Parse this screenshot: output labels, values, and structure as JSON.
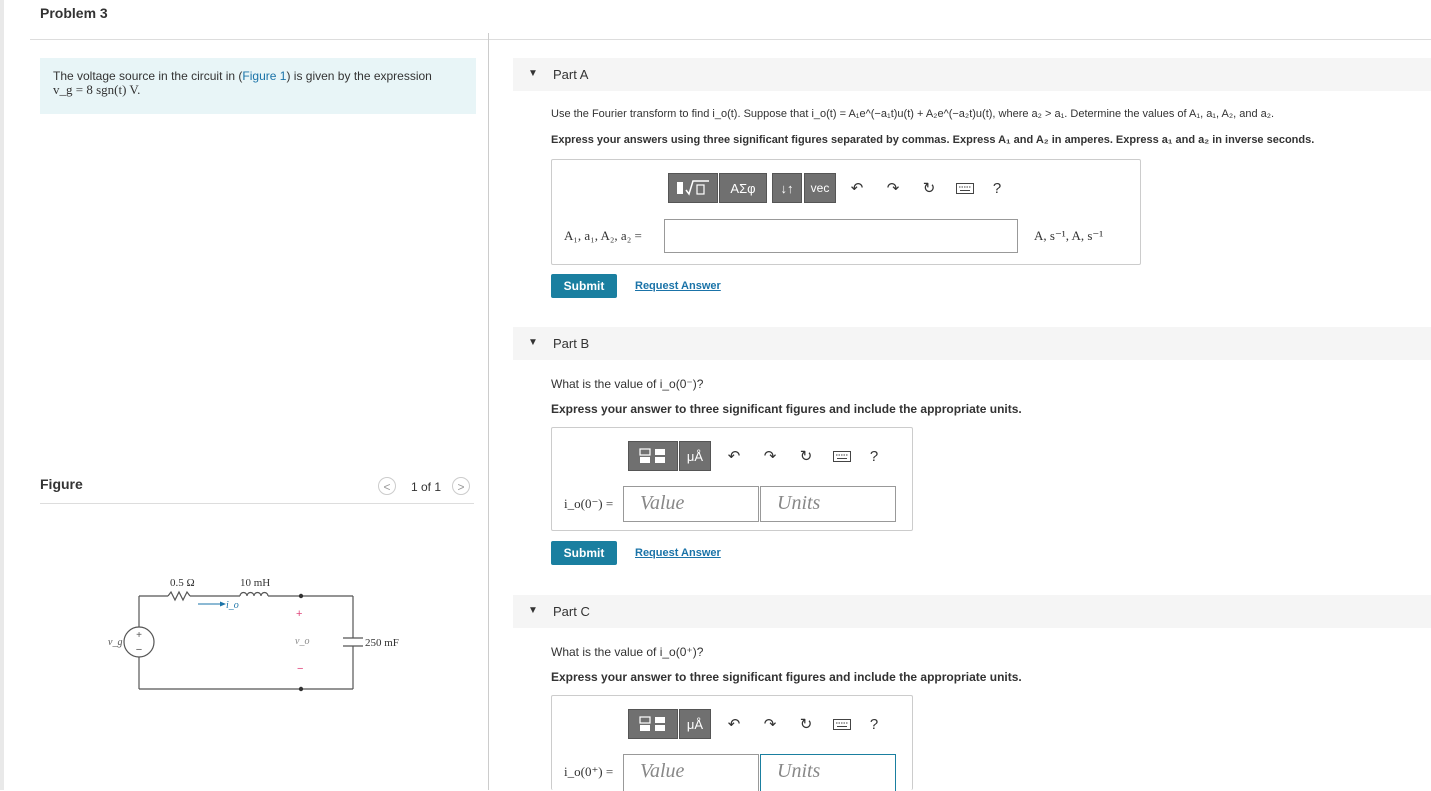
{
  "problem": {
    "title": "Problem 3"
  },
  "statement": {
    "text_before": "The voltage source in the circuit in (",
    "figure_link": "Figure 1",
    "text_after": ") is given by the expression",
    "expr": "v_g = 8 sgn(t) V."
  },
  "figure": {
    "label": "Figure",
    "pager": {
      "prev": "<",
      "count": "1 of 1",
      "next": ">"
    },
    "circuit": {
      "resistor": "0.5 Ω",
      "inductor": "10 mH",
      "capacitor": "250 mF",
      "source": "v_g",
      "current": "i_o",
      "voltage": "v_o",
      "plus": "+",
      "minus": "−"
    }
  },
  "parts": {
    "a": {
      "title": "Part A",
      "question": "Use the Fourier transform to find i_o(t). Suppose that i_o(t) = A₁e^(−a₁t)u(t) + A₂e^(−a₂t)u(t), where a₂ > a₁. Determine the values of A₁, a₁, A₂, and a₂.",
      "instruction": "Express your answers using three significant figures separated by commas. Express A₁ and A₂ in amperes. Express a₁ and a₂ in inverse seconds.",
      "toolbar": {
        "greek": "ΑΣφ",
        "arrows": "↓↑",
        "vec": "vec",
        "help": "?"
      },
      "input_label": "A₁, a₁, A₂, a₂ =",
      "input_value": "",
      "units": "A, s⁻¹, A, s⁻¹",
      "submit": "Submit",
      "request": "Request Answer"
    },
    "b": {
      "title": "Part B",
      "question": "What is the value of i_o(0⁻)?",
      "instruction": "Express your answer to three significant figures and include the appropriate units.",
      "toolbar": {
        "units": "μÅ",
        "help": "?"
      },
      "input_label": "i_o(0⁻) =",
      "value_placeholder": "Value",
      "units_placeholder": "Units",
      "submit": "Submit",
      "request": "Request Answer"
    },
    "c": {
      "title": "Part C",
      "question": "What is the value of i_o(0⁺)?",
      "instruction": "Express your answer to three significant figures and include the appropriate units.",
      "toolbar": {
        "units": "μÅ",
        "help": "?"
      },
      "input_label": "i_o(0⁺) =",
      "value_placeholder": "Value",
      "units_placeholder": "Units"
    }
  },
  "colors": {
    "accent": "#1a7fa0",
    "link": "#1a73a8",
    "statement_bg": "#e8f5f7",
    "toolbar_btn": "#707070"
  }
}
